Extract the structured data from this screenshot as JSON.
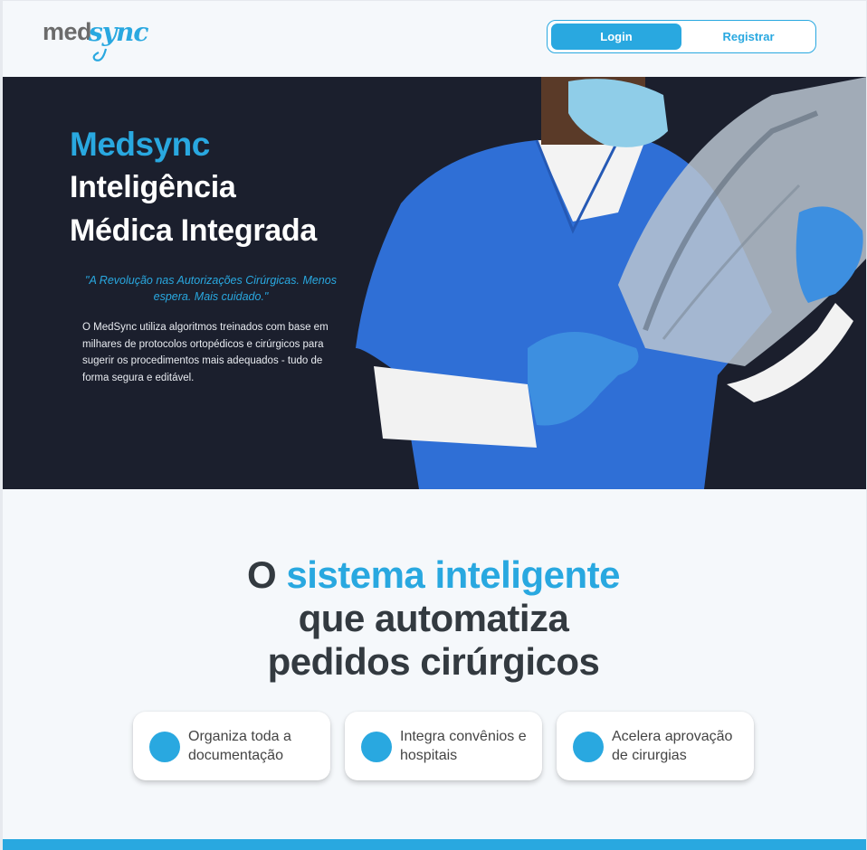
{
  "header": {
    "logo_med": "med",
    "logo_sync": "sync",
    "login_label": "Login",
    "register_label": "Registrar"
  },
  "hero": {
    "brand": "Medsync",
    "title_line1": "Inteligência",
    "title_line2": "Médica Integrada",
    "quote": "\"A Revolução nas Autorizações Cirúrgicas. Menos espera. Mais cuidado.\"",
    "description": "O MedSync utiliza algoritmos treinados com base em milhares de protocolos ortopédicos e cirúrgicos para sugerir os procedimentos mais adequados - tudo de forma segura e editável."
  },
  "main": {
    "headline_pre": "O ",
    "headline_accent": "sistema inteligente",
    "headline_line2": "que automatiza",
    "headline_line3": "pedidos cirúrgicos",
    "features": [
      {
        "label": "Organiza toda a documentação"
      },
      {
        "label": "Integra convênios e hospitais"
      },
      {
        "label": "Acelera aprovação de cirurgias"
      }
    ]
  },
  "colors": {
    "accent": "#29a8e0",
    "hero_bg": "#1b1f2d",
    "scrubs": "#2f6fd6"
  }
}
